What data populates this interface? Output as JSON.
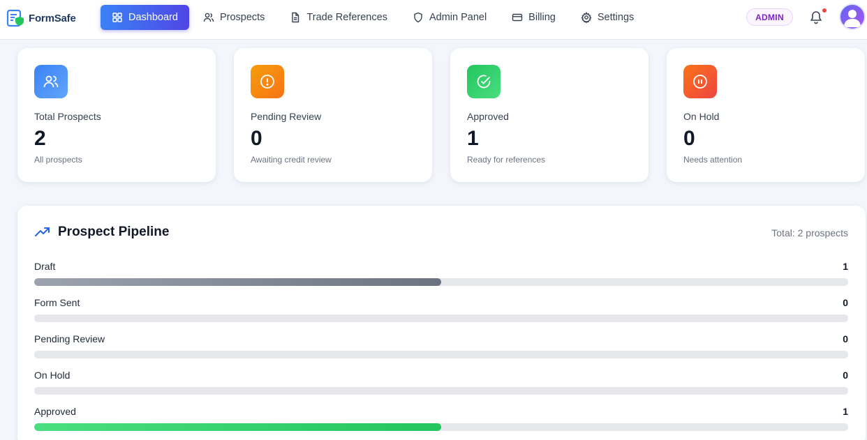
{
  "app": {
    "logo_text": "FormSafe"
  },
  "nav": [
    {
      "label": "Dashboard",
      "icon": "dashboard-grid-icon",
      "active": true
    },
    {
      "label": "Prospects",
      "icon": "users-icon",
      "active": false
    },
    {
      "label": "Trade References",
      "icon": "document-icon",
      "active": false
    },
    {
      "label": "Admin Panel",
      "icon": "shield-icon",
      "active": false
    },
    {
      "label": "Billing",
      "icon": "credit-card-icon",
      "active": false
    },
    {
      "label": "Settings",
      "icon": "gear-icon",
      "active": false
    }
  ],
  "header": {
    "role_badge": "ADMIN",
    "has_notification": true
  },
  "stats": [
    {
      "label": "Total Prospects",
      "value": "2",
      "sub": "All prospects",
      "icon": "users-icon",
      "color_from": "#3b82f6",
      "color_to": "#60a5fa"
    },
    {
      "label": "Pending Review",
      "value": "0",
      "sub": "Awaiting credit review",
      "icon": "alert-circle-icon",
      "color_from": "#f59e0b",
      "color_to": "#f97316"
    },
    {
      "label": "Approved",
      "value": "1",
      "sub": "Ready for references",
      "icon": "check-circle-icon",
      "color_from": "#22c55e",
      "color_to": "#4ade80"
    },
    {
      "label": "On Hold",
      "value": "0",
      "sub": "Needs attention",
      "icon": "pause-circle-icon",
      "color_from": "#f97316",
      "color_to": "#ef4444"
    }
  ],
  "pipeline": {
    "title": "Prospect Pipeline",
    "total_text": "Total: 2 prospects",
    "stages": [
      {
        "label": "Draft",
        "count": "1",
        "fraction": 0.5,
        "color_from": "#9ca3af",
        "color_to": "#6b7280"
      },
      {
        "label": "Form Sent",
        "count": "0",
        "fraction": 0,
        "color_from": "#9ca3af",
        "color_to": "#6b7280"
      },
      {
        "label": "Pending Review",
        "count": "0",
        "fraction": 0,
        "color_from": "#f59e0b",
        "color_to": "#f97316"
      },
      {
        "label": "On Hold",
        "count": "0",
        "fraction": 0,
        "color_from": "#f97316",
        "color_to": "#ef4444"
      },
      {
        "label": "Approved",
        "count": "1",
        "fraction": 0.5,
        "color_from": "#4ade80",
        "color_to": "#22c55e"
      }
    ]
  }
}
